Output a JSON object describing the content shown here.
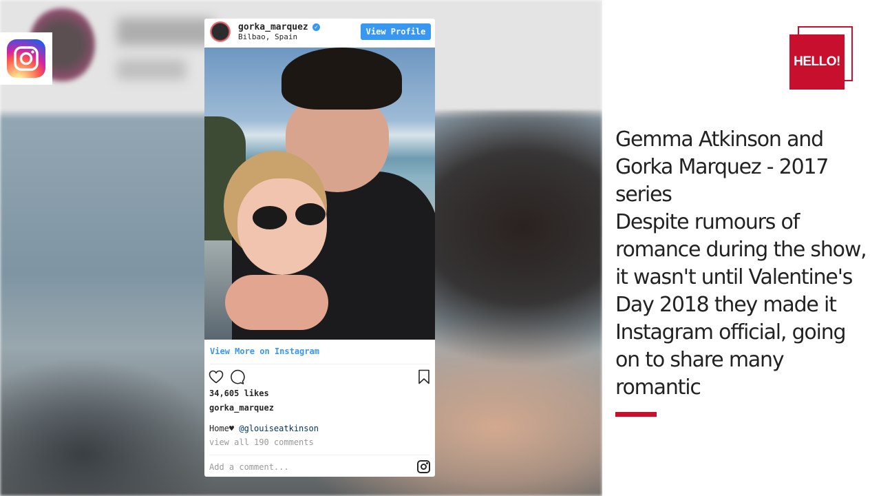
{
  "instagram_embed": {
    "username": "gorka_marquez",
    "location": "Bilbao, Spain",
    "view_profile_label": "View Profile",
    "view_more_label": "View More on Instagram",
    "likes": "34,605 likes",
    "poster": "gorka_marquez",
    "caption_text": "Home♥ ",
    "caption_mention": "@glouiseatkinson",
    "comments_link": "view all 190 comments",
    "add_comment_placeholder": "Add a comment..."
  },
  "brand": {
    "logo_text": "HELLO!",
    "accent_color": "#c8102e"
  },
  "article": {
    "heading": "Gemma Atkinson and Gorka Marquez - 2017 series",
    "body": "Despite rumours of romance during the show, it wasn't until Valentine's Day 2018 they made it Instagram official, going on to share many romantic"
  },
  "icons": [
    "instagram-icon",
    "verified-badge-icon",
    "heart-icon",
    "comment-icon",
    "bookmark-icon",
    "instagram-glyph-icon"
  ]
}
